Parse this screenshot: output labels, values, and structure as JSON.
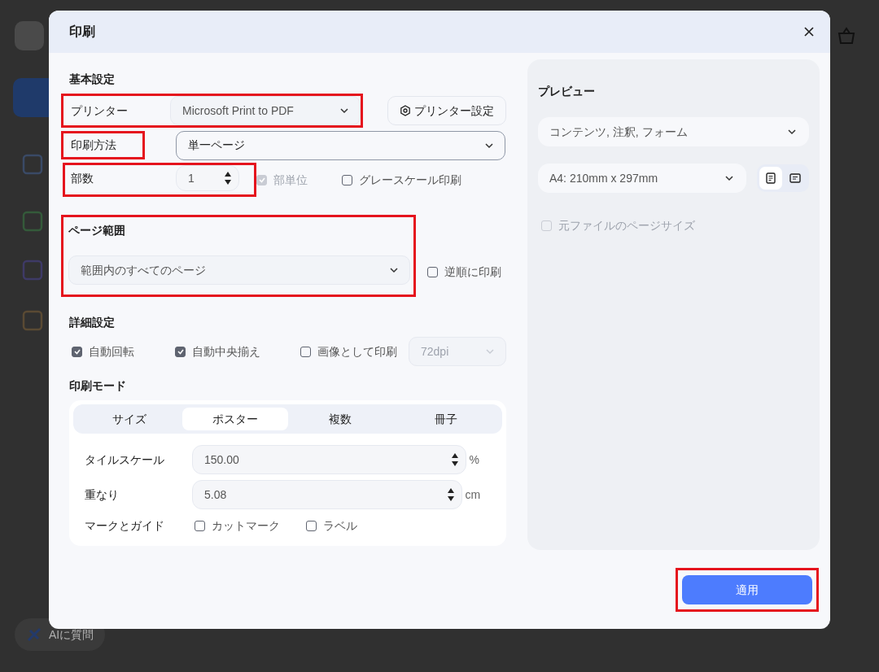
{
  "dialog": {
    "title": "印刷"
  },
  "basic": {
    "heading": "基本設定",
    "printer": {
      "label": "プリンター",
      "value": "Microsoft Print to PDF",
      "highlighted": true
    },
    "printer_settings_button": "プリンター設定",
    "method": {
      "label": "印刷方法",
      "value": "単一ページ",
      "highlighted": true
    },
    "copies": {
      "label": "部数",
      "value": "1",
      "highlighted": true
    },
    "options": [
      {
        "label": "部単位",
        "checked": true,
        "disabled": true
      },
      {
        "label": "グレースケール印刷",
        "checked": false,
        "disabled": false
      }
    ]
  },
  "page_range": {
    "heading": "ページ範囲",
    "value": "範囲内のすべてのページ",
    "highlighted": true,
    "reverse": {
      "label": "逆順に印刷",
      "checked": false,
      "disabled": false
    }
  },
  "advanced": {
    "heading": "詳細設定",
    "options": [
      {
        "label": "自動回転",
        "checked": true,
        "disabled": false
      },
      {
        "label": "自動中央揃え",
        "checked": true,
        "disabled": false
      },
      {
        "label": "画像として印刷",
        "checked": false,
        "disabled": false
      }
    ],
    "dpi": {
      "value": "72dpi",
      "disabled": true
    }
  },
  "print_mode": {
    "heading": "印刷モード",
    "tabs": [
      {
        "label": "サイズ",
        "selected": false
      },
      {
        "label": "ポスター",
        "selected": true
      },
      {
        "label": "複数",
        "selected": false
      },
      {
        "label": "冊子",
        "selected": false
      }
    ],
    "fields": [
      {
        "label": "タイルスケール",
        "value": "150.00",
        "unit": "%"
      },
      {
        "label": "重なり",
        "value": "5.08",
        "unit": "cm"
      }
    ],
    "marks": {
      "label": "マークとガイド",
      "options": [
        {
          "label": "カットマーク",
          "checked": false,
          "disabled": false
        },
        {
          "label": "ラベル",
          "checked": false,
          "disabled": false
        }
      ]
    }
  },
  "preview": {
    "heading": "プレビュー",
    "content": "コンテンツ, 注釈, フォーム",
    "paper": "A4: 210mm x 297mm",
    "orientations": [
      {
        "kind": "portrait",
        "selected": true
      },
      {
        "kind": "landscape",
        "selected": false
      }
    ],
    "original_size": {
      "label": "元ファイルのページサイズ",
      "checked": false,
      "disabled": true
    }
  },
  "apply_button": {
    "label": "適用",
    "highlighted": true
  },
  "background": {
    "ask_ai": "AIに質問"
  }
}
